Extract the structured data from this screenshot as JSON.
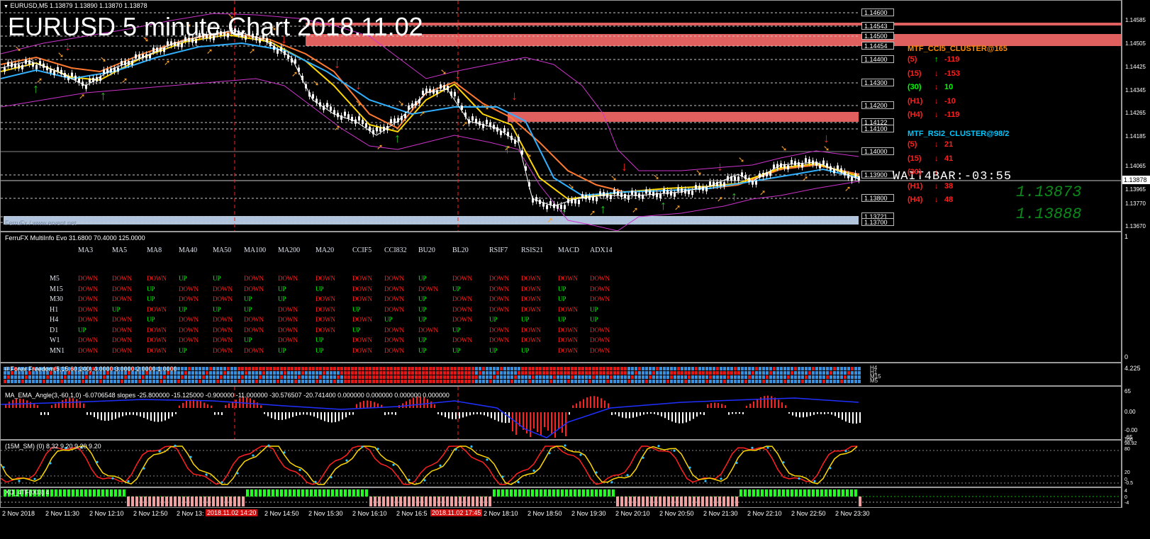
{
  "main": {
    "symbol_line": "EURUSD,M5  1.13879 1.13890 1.13870 1.13878",
    "big_title": "EURUSD 5 minute Chart 2018.11.02",
    "watermark": "FerruFx / www.ervent.net",
    "price_levels": [
      "1.14600",
      "1.14543",
      "1.14500",
      "1.14454",
      "1.14400",
      "1.14300",
      "1.14200",
      "1.14122",
      "1.14100",
      "1.14000",
      "1.13900",
      "1.13800",
      "1.13721",
      "1.13700"
    ],
    "axis_ticks": [
      "1.14585",
      "1.14505",
      "1.14425",
      "1.14345",
      "1.14265",
      "1.14185",
      "1.14065",
      "1.13965",
      "1.13878",
      "1.13770",
      "1.13670"
    ],
    "current_price": "1.13878",
    "bar_timer": "WAIT4BAR:-03:55",
    "big_price_1": "1.13873",
    "big_price_2": "1.13888",
    "cci_title": "MTF_CCI5_CLUSTER@165",
    "cci_rows": [
      {
        "tf": "(5)",
        "arrow": "↑",
        "val": "-119",
        "color": "#ff2020",
        "arrow_color": "#00ff00"
      },
      {
        "tf": "(15)",
        "arrow": "↓",
        "val": "-153",
        "color": "#ff2020",
        "arrow_color": "#ff2020"
      },
      {
        "tf": "(30)",
        "arrow": "↓",
        "val": "10",
        "color": "#00ff00",
        "arrow_color": "#ff2020"
      },
      {
        "tf": "(H1)",
        "arrow": "↓",
        "val": "-10",
        "color": "#ff2020",
        "arrow_color": "#ff2020"
      },
      {
        "tf": "(H4)",
        "arrow": "↓",
        "val": "-119",
        "color": "#ff2020",
        "arrow_color": "#ff2020"
      }
    ],
    "rsi_title": "MTF_RSI2_CLUSTER@98/2",
    "rsi_rows": [
      {
        "tf": "(5)",
        "arrow": "↓",
        "val": "21"
      },
      {
        "tf": "(15)",
        "arrow": "↓",
        "val": "41"
      },
      {
        "tf": "(30)",
        "arrow": "↓",
        "val": ""
      },
      {
        "tf": "(H1)",
        "arrow": "↓",
        "val": "38"
      },
      {
        "tf": "(H4)",
        "arrow": "↓",
        "val": "48"
      }
    ],
    "colors": {
      "cci_title": "#ff8c00",
      "rsi_title": "#00c8ff",
      "zone": "#e06060",
      "zone_low": "#b0c4de"
    }
  },
  "multiinfo": {
    "title": "FerruFX MultiInfo Evo 31.6800 70.4000 125.0000",
    "axis_top": "1",
    "axis_bottom": "0",
    "columns": [
      "MA3",
      "MA5",
      "MA8",
      "MA40",
      "MA50",
      "MA100",
      "MA200",
      "MA20",
      "CCIF5",
      "CCI832",
      "BU20",
      "BL20",
      "RSIF7",
      "RSIS21",
      "MACD",
      "ADX14"
    ],
    "rows": [
      {
        "tf": "M5",
        "vals": [
          "DOWN",
          "DOWN",
          "DOWN",
          "UP",
          "UP",
          "DOWN",
          "DOWN",
          "DOWN",
          "DOWN",
          "DOWN",
          "UP",
          "DOWN",
          "DOWN",
          "DOWN",
          "DOWN",
          "DOWN"
        ]
      },
      {
        "tf": "M15",
        "vals": [
          "DOWN",
          "DOWN",
          "UP",
          "DOWN",
          "DOWN",
          "DOWN",
          "UP",
          "UP",
          "DOWN",
          "DOWN",
          "DOWN",
          "UP",
          "DOWN",
          "DOWN",
          "UP",
          "DOWN"
        ]
      },
      {
        "tf": "M30",
        "vals": [
          "DOWN",
          "DOWN",
          "UP",
          "DOWN",
          "DOWN",
          "UP",
          "UP",
          "DOWN",
          "DOWN",
          "DOWN",
          "UP",
          "DOWN",
          "DOWN",
          "DOWN",
          "UP",
          "DOWN"
        ]
      },
      {
        "tf": "H1",
        "vals": [
          "DOWN",
          "UP",
          "DOWN",
          "UP",
          "UP",
          "UP",
          "DOWN",
          "DOWN",
          "UP",
          "DOWN",
          "UP",
          "DOWN",
          "DOWN",
          "DOWN",
          "DOWN",
          "UP"
        ]
      },
      {
        "tf": "H4",
        "vals": [
          "DOWN",
          "DOWN",
          "UP",
          "DOWN",
          "DOWN",
          "DOWN",
          "DOWN",
          "DOWN",
          "DOWN",
          "UP",
          "UP",
          "DOWN",
          "UP",
          "UP",
          "UP",
          "UP"
        ]
      },
      {
        "tf": "D1",
        "vals": [
          "UP",
          "DOWN",
          "DOWN",
          "DOWN",
          "DOWN",
          "DOWN",
          "DOWN",
          "DOWN",
          "UP",
          "DOWN",
          "DOWN",
          "UP",
          "DOWN",
          "DOWN",
          "DOWN",
          "DOWN"
        ]
      },
      {
        "tf": "W1",
        "vals": [
          "DOWN",
          "DOWN",
          "DOWN",
          "DOWN",
          "DOWN",
          "UP",
          "DOWN",
          "UP",
          "DOWN",
          "DOWN",
          "UP",
          "DOWN",
          "DOWN",
          "DOWN",
          "DOWN",
          "DOWN"
        ]
      },
      {
        "tf": "MN1",
        "vals": [
          "DOWN",
          "DOWN",
          "DOWN",
          "UP",
          "DOWN",
          "DOWN",
          "UP",
          "UP",
          "DOWN",
          "DOWN",
          "UP",
          "UP",
          "UP",
          "UP",
          "DOWN",
          "DOWN"
        ]
      }
    ]
  },
  "freedom": {
    "title": "# Forex Freedom(5,15,60,240) 4.0000 3.0000 2.0000 1.0000",
    "axis": "4.225",
    "labels": [
      "H4",
      "H1",
      "M15",
      "M5"
    ]
  },
  "angle": {
    "title": "MA_EMA_Angle(3,-60,1,0) -6.0706548  slopes -25.800000 -15.125000 -0.900000 -11.000000 -30.576507 -20.741400 0.000000 0.000000 0.000000 0.000000",
    "axis": [
      "65",
      "0.00",
      "-0.00",
      "-65"
    ]
  },
  "stoch": {
    "title": "(15M_SM)  (0) 8.32 9.20 9.20 9.20",
    "axis": [
      "100",
      "98.92",
      "80",
      "20",
      "0",
      "-0.5"
    ]
  },
  "xo": {
    "title": "XO_4TF(003) 4",
    "axis": [
      "4",
      "0",
      "-4"
    ]
  },
  "time_axis": {
    "labels": [
      "2 Nov 2018",
      "2 Nov 11:30",
      "2 Nov 12:10",
      "2 Nov 12:50",
      "2 Nov 13:",
      "2 Nov 14:50",
      "2 Nov 15:30",
      "2 Nov 16:10",
      "2 Nov 16:5",
      "2 Nov 18:10",
      "2 Nov 18:50",
      "2 Nov 19:30",
      "2 Nov 20:10",
      "2 Nov 20:50",
      "2 Nov 21:30",
      "2 Nov 22:10",
      "2 Nov 22:50",
      "2 Nov 23:30"
    ],
    "markers": [
      "2018.11.02 14:20",
      "2018.11.02 17:45"
    ]
  }
}
